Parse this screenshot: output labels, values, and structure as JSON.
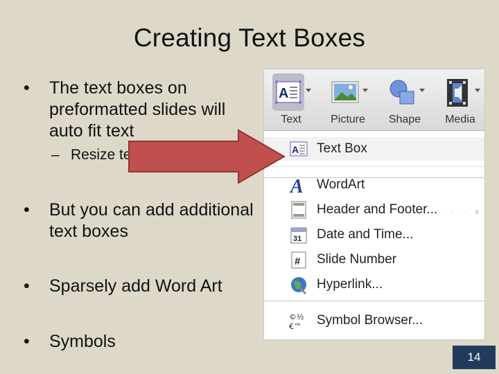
{
  "slide": {
    "title": "Creating Text Boxes",
    "bullets": [
      "The text boxes on preformatted slides will auto fit text",
      "But you can add additional text boxes",
      "Sparsely add Word Art",
      "Symbols"
    ],
    "sub_bullet": "Resize text",
    "bullet_glyph": "•",
    "dash_glyph": "–",
    "page_number": "14"
  },
  "screenshot": {
    "toolbar": [
      {
        "label": "Text",
        "icon": "text-box-icon"
      },
      {
        "label": "Picture",
        "icon": "picture-icon"
      },
      {
        "label": "Shape",
        "icon": "shape-icon"
      },
      {
        "label": "Media",
        "icon": "media-icon"
      }
    ],
    "menu_items": [
      {
        "label": "Text Box",
        "icon": "text-box-icon"
      },
      {
        "label": "WordArt",
        "icon": "wordart-icon"
      },
      {
        "label": "Header and Footer...",
        "icon": "header-footer-icon"
      },
      {
        "label": "Date and Time...",
        "icon": "calendar-icon"
      },
      {
        "label": "Slide Number",
        "icon": "hash-icon"
      },
      {
        "label": "Hyperlink...",
        "icon": "globe-link-icon"
      },
      {
        "label": "Symbol Browser...",
        "icon": "symbols-icon"
      }
    ]
  },
  "colors": {
    "background": "#ddd8c8",
    "arrow": "#c0504d",
    "page_box": "#223b5c"
  }
}
